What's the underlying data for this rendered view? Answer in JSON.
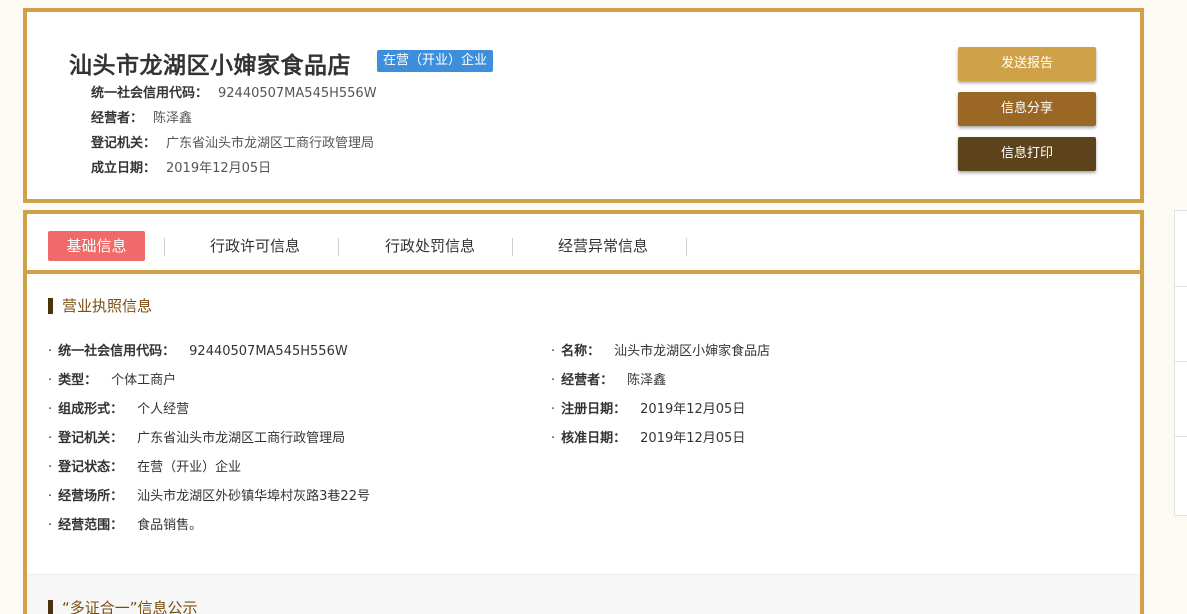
{
  "company": {
    "name": "汕头市龙湖区小婶家食品店",
    "status_badge": "在营（开业）企业",
    "rows": [
      {
        "label": "统一社会信用代码：",
        "value": "92440507MA545H556W"
      },
      {
        "label": "经营者：",
        "value": "陈泽鑫"
      },
      {
        "label": "登记机关：",
        "value": "广东省汕头市龙湖区工商行政管理局"
      },
      {
        "label": "成立日期：",
        "value": "2019年12月05日"
      }
    ]
  },
  "actions": {
    "report": "发送报告",
    "share": "信息分享",
    "print": "信息打印"
  },
  "tabs": [
    "基础信息",
    "行政许可信息",
    "行政处罚信息",
    "经营异常信息"
  ],
  "license": {
    "title": "营业执照信息",
    "left": [
      {
        "label": "统一社会信用代码：",
        "value": "92440507MA545H556W"
      },
      {
        "label": "类型：",
        "value": "个体工商户"
      },
      {
        "label": "组成形式：",
        "value": "个人经营"
      },
      {
        "label": "登记机关：",
        "value": "广东省汕头市龙湖区工商行政管理局"
      },
      {
        "label": "登记状态：",
        "value": "在营（开业）企业"
      },
      {
        "label": "经营场所：",
        "value": "汕头市龙湖区外砂镇华埠村灰路3巷22号"
      },
      {
        "label": "经营范围：",
        "value": "食品销售。"
      }
    ],
    "right": [
      {
        "label": "名称：",
        "value": "汕头市龙湖区小婶家食品店"
      },
      {
        "label": "经营者：",
        "value": "陈泽鑫"
      },
      {
        "label": "注册日期：",
        "value": "2019年12月05日"
      },
      {
        "label": "核准日期：",
        "value": "2019年12月05日"
      }
    ]
  },
  "next_section": {
    "title": "“多证合一”信息公示"
  },
  "colors": {
    "gold_border": "#cfa24a",
    "badge_blue": "#3d8fdc",
    "active_tab": "#f06a6a",
    "btn_report": "#cfa24a",
    "btn_share": "#9a6724",
    "btn_print": "#5c431b"
  }
}
